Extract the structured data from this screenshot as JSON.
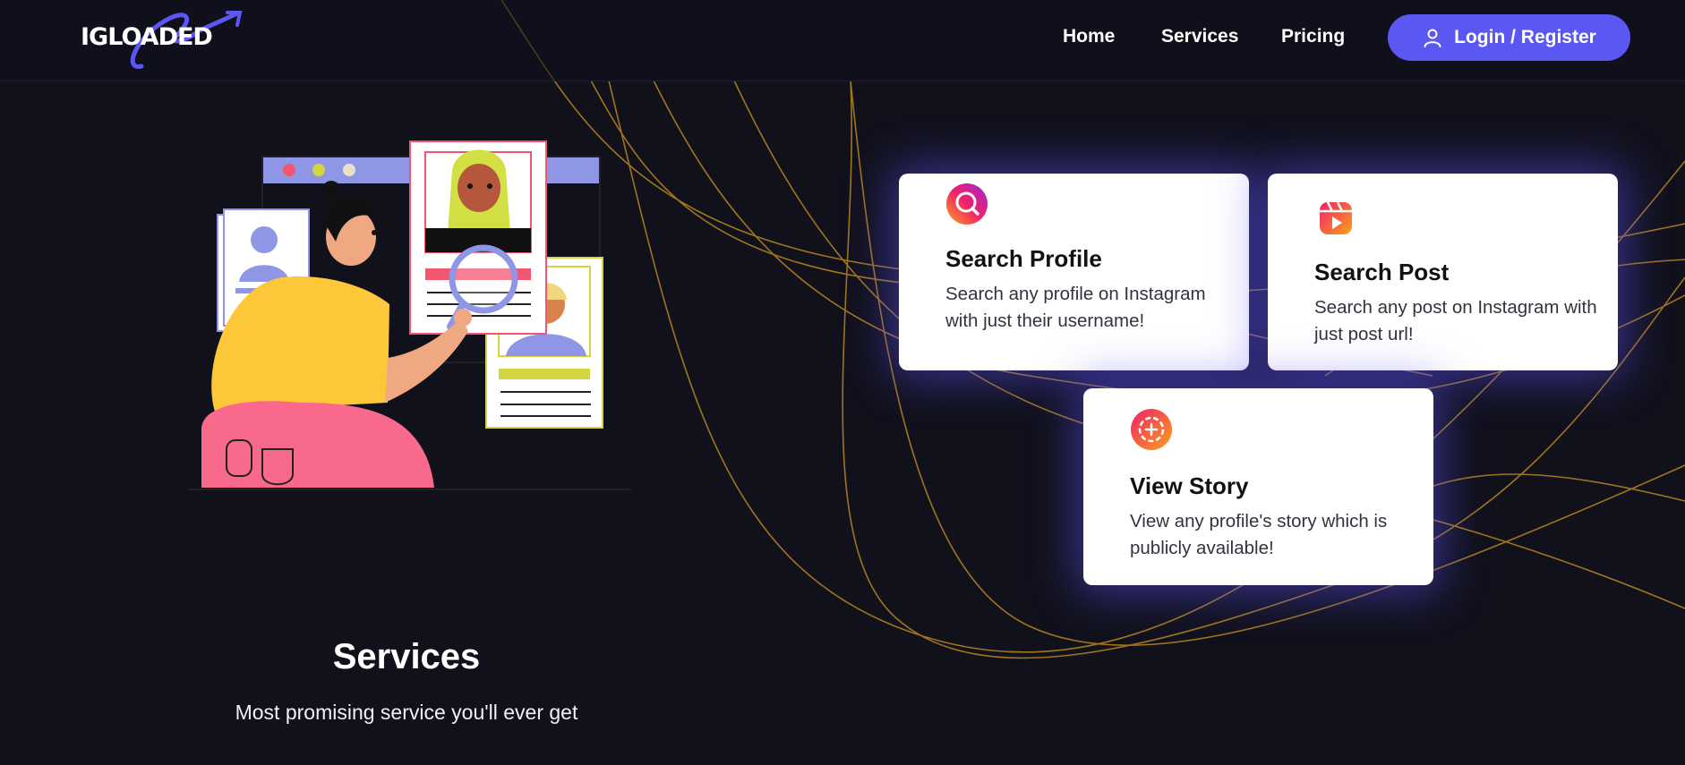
{
  "brand": {
    "name": "IGLOADED",
    "accent": "#5b57f3"
  },
  "nav": {
    "home": "Home",
    "services": "Services",
    "pricing": "Pricing",
    "login": "Login / Register"
  },
  "hero": {
    "title": "Services",
    "subtitle": "Most promising service you'll ever get"
  },
  "cards": [
    {
      "title": "Search Profile",
      "description": "Search any profile on Instagram with just their username!",
      "icon": "search-profile-icon"
    },
    {
      "title": "Search Post",
      "description": "Search any post on Instagram with just post url!",
      "icon": "reels-icon"
    },
    {
      "title": "View Story",
      "description": "View any profile's story which is publicly available!",
      "icon": "story-add-icon"
    }
  ],
  "colors": {
    "background": "#11111c",
    "curves": "#c8901e",
    "card_glow": "#5a50f0"
  }
}
